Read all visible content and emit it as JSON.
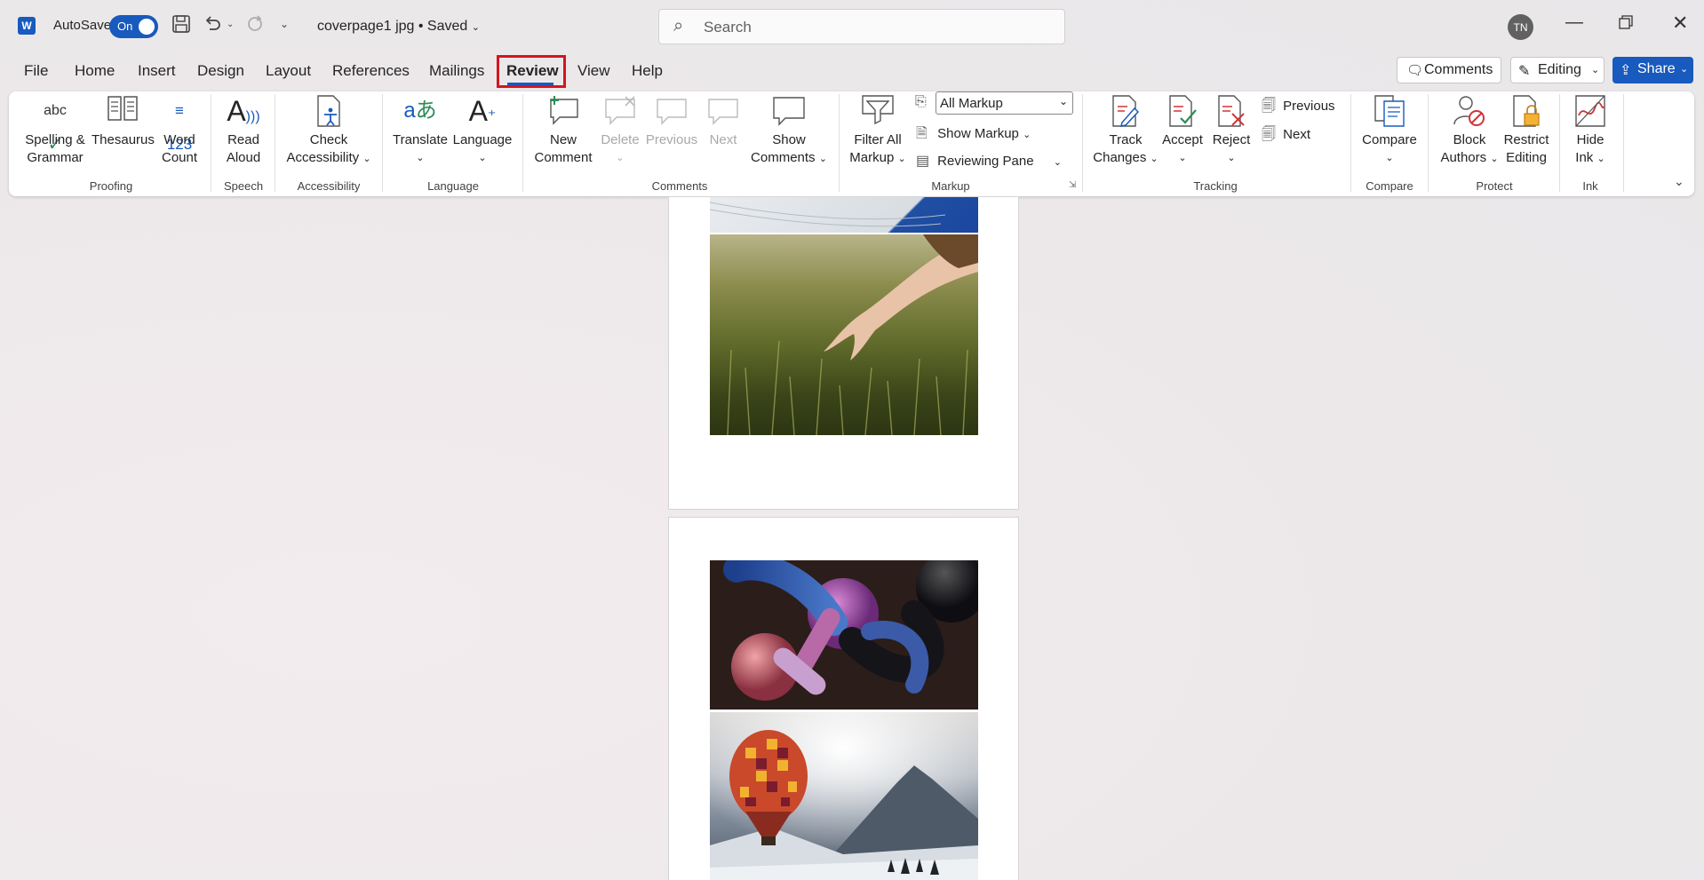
{
  "titlebar": {
    "autosave_label": "AutoSave",
    "autosave_state": "On",
    "document_name": "coverpage1 jpg",
    "saved_status": "• Saved",
    "search_placeholder": "Search",
    "avatar_initials": "TN"
  },
  "tabs": [
    "File",
    "Home",
    "Insert",
    "Design",
    "Layout",
    "References",
    "Mailings",
    "Review",
    "View",
    "Help"
  ],
  "active_tab": "Review",
  "right_buttons": {
    "comments": "Comments",
    "editing": "Editing",
    "share": "Share"
  },
  "ribbon": {
    "proofing": {
      "spelling": "Spelling &",
      "spelling2": "Grammar",
      "thesaurus": "Thesaurus",
      "word_count": "Word",
      "word_count2": "Count",
      "group": "Proofing"
    },
    "speech": {
      "read_aloud": "Read",
      "read_aloud2": "Aloud",
      "group": "Speech"
    },
    "accessibility": {
      "check": "Check",
      "check2": "Accessibility",
      "group": "Accessibility"
    },
    "language": {
      "translate": "Translate",
      "language": "Language",
      "group": "Language"
    },
    "comments": {
      "new": "New",
      "new2": "Comment",
      "delete": "Delete",
      "previous": "Previous",
      "next": "Next",
      "show": "Show",
      "show2": "Comments",
      "group": "Comments"
    },
    "markup": {
      "filter": "Filter All",
      "filter2": "Markup",
      "all_markup": "All Markup",
      "show_markup": "Show Markup",
      "reviewing_pane": "Reviewing Pane",
      "group": "Markup"
    },
    "tracking": {
      "track": "Track",
      "track2": "Changes",
      "accept": "Accept",
      "reject": "Reject",
      "previous": "Previous",
      "next": "Next",
      "group": "Tracking"
    },
    "compare": {
      "compare": "Compare",
      "group": "Compare"
    },
    "protect": {
      "block": "Block",
      "block2": "Authors",
      "restrict": "Restrict",
      "restrict2": "Editing",
      "group": "Protect"
    },
    "ink": {
      "hide": "Hide",
      "hide2": "Ink",
      "group": "Ink"
    }
  },
  "colors": {
    "accent": "#185abd",
    "highlight": "#d6141e"
  }
}
